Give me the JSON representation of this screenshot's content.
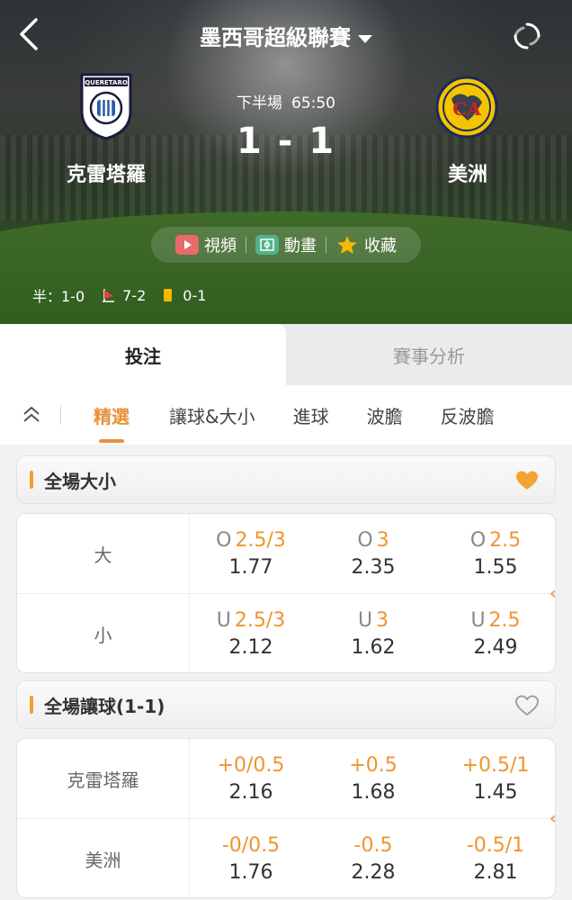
{
  "header": {
    "league": "墨西哥超級聯賽",
    "period": "下半場",
    "clock": "65:50",
    "score": "1 - 1",
    "home": {
      "name": "克雷塔羅",
      "logo_text": "QUERETARO"
    },
    "away": {
      "name": "美洲",
      "logo_text": "CA"
    },
    "media": [
      {
        "label": "視頻",
        "icon": "video-icon"
      },
      {
        "label": "動畫",
        "icon": "animation-icon"
      },
      {
        "label": "收藏",
        "icon": "star-icon"
      }
    ],
    "stats": {
      "half": "半：1-0",
      "corners": "7-2",
      "yellow": "0-1"
    }
  },
  "main_tabs": [
    "投注",
    "賽事分析"
  ],
  "sub_tabs": [
    "精選",
    "讓球&大小",
    "進球",
    "波膽",
    "反波膽"
  ],
  "sections": [
    {
      "title": "全場大小",
      "favorited": true,
      "rows": [
        {
          "label": "大",
          "cells": [
            {
              "pre": "O",
              "line": "2.5/3",
              "price": "1.77"
            },
            {
              "pre": "O",
              "line": "3",
              "price": "2.35"
            },
            {
              "pre": "O",
              "line": "2.5",
              "price": "1.55"
            }
          ]
        },
        {
          "label": "小",
          "cells": [
            {
              "pre": "U",
              "line": "2.5/3",
              "price": "2.12"
            },
            {
              "pre": "U",
              "line": "3",
              "price": "1.62"
            },
            {
              "pre": "U",
              "line": "2.5",
              "price": "2.49"
            }
          ]
        }
      ]
    },
    {
      "title": "全場讓球(1-1)",
      "favorited": false,
      "rows": [
        {
          "label": "克雷塔羅",
          "cells": [
            {
              "pre": "",
              "line": "+0/0.5",
              "price": "2.16"
            },
            {
              "pre": "",
              "line": "+0.5",
              "price": "1.68"
            },
            {
              "pre": "",
              "line": "+0.5/1",
              "price": "1.45"
            }
          ]
        },
        {
          "label": "美洲",
          "cells": [
            {
              "pre": "",
              "line": "-0/0.5",
              "price": "1.76"
            },
            {
              "pre": "",
              "line": "-0.5",
              "price": "2.28"
            },
            {
              "pre": "",
              "line": "-0.5/1",
              "price": "2.81"
            }
          ]
        }
      ]
    }
  ],
  "colors": {
    "accent": "#e8913a",
    "odds_line": "#f0952e"
  }
}
